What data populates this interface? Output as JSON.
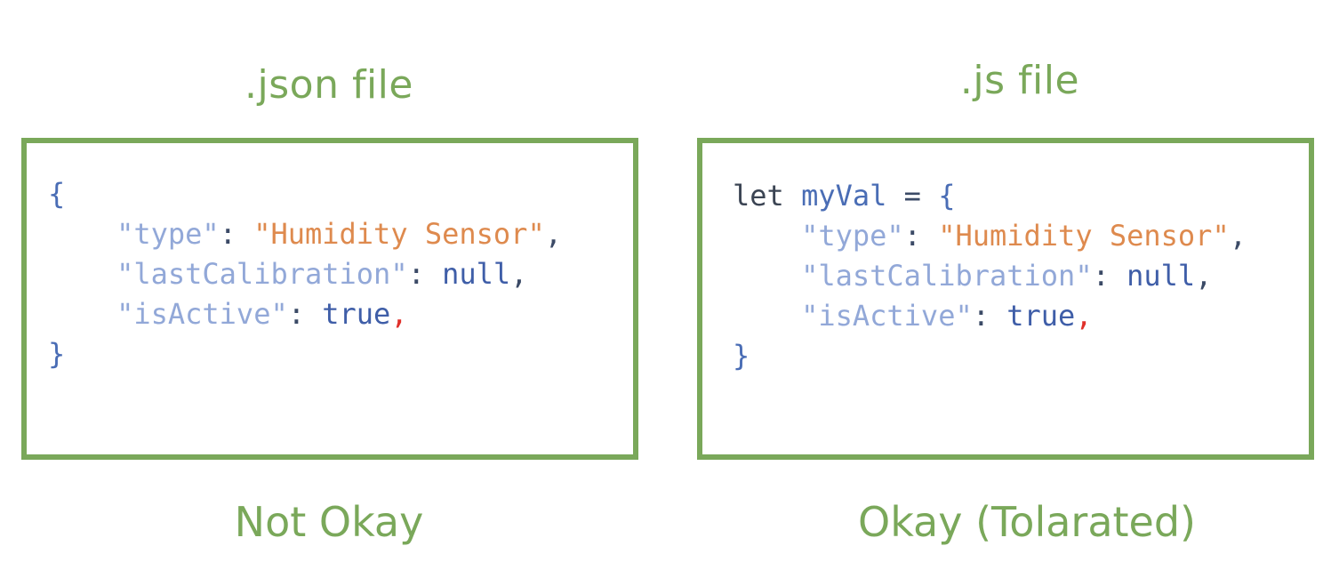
{
  "left": {
    "title": ".json file",
    "verdict": "Not Okay",
    "code": {
      "open": "{",
      "lines": [
        {
          "key": "\"type\"",
          "sep": ": ",
          "value": "\"Humidity Sensor\"",
          "value_kind": "string",
          "trail": ","
        },
        {
          "key": "\"lastCalibration\"",
          "sep": ": ",
          "value": "null",
          "value_kind": "literal",
          "trail": ","
        },
        {
          "key": "\"isActive\"",
          "sep": ": ",
          "value": "true",
          "value_kind": "literal",
          "trail": ","
        }
      ],
      "close": "}"
    }
  },
  "right": {
    "title": ".js file",
    "verdict": "Okay (Tolarated)",
    "code": {
      "keyword": "let",
      "variable": "myVal",
      "assign": " = ",
      "open": "{",
      "lines": [
        {
          "key": "\"type\"",
          "sep": ": ",
          "value": "\"Humidity Sensor\"",
          "value_kind": "string",
          "trail": ","
        },
        {
          "key": "\"lastCalibration\"",
          "sep": ": ",
          "value": "null",
          "value_kind": "literal",
          "trail": ","
        },
        {
          "key": "\"isActive\"",
          "sep": ": ",
          "value": "true",
          "value_kind": "literal",
          "trail": ","
        }
      ],
      "close": "}"
    }
  },
  "colors": {
    "accent_green": "#7aa85a",
    "brace_blue": "#4a6db5",
    "key_lightblue": "#92a8d8",
    "string_orange": "#de8a4e",
    "literal_blue": "#3f5ea8",
    "error_red": "#e0302a"
  }
}
